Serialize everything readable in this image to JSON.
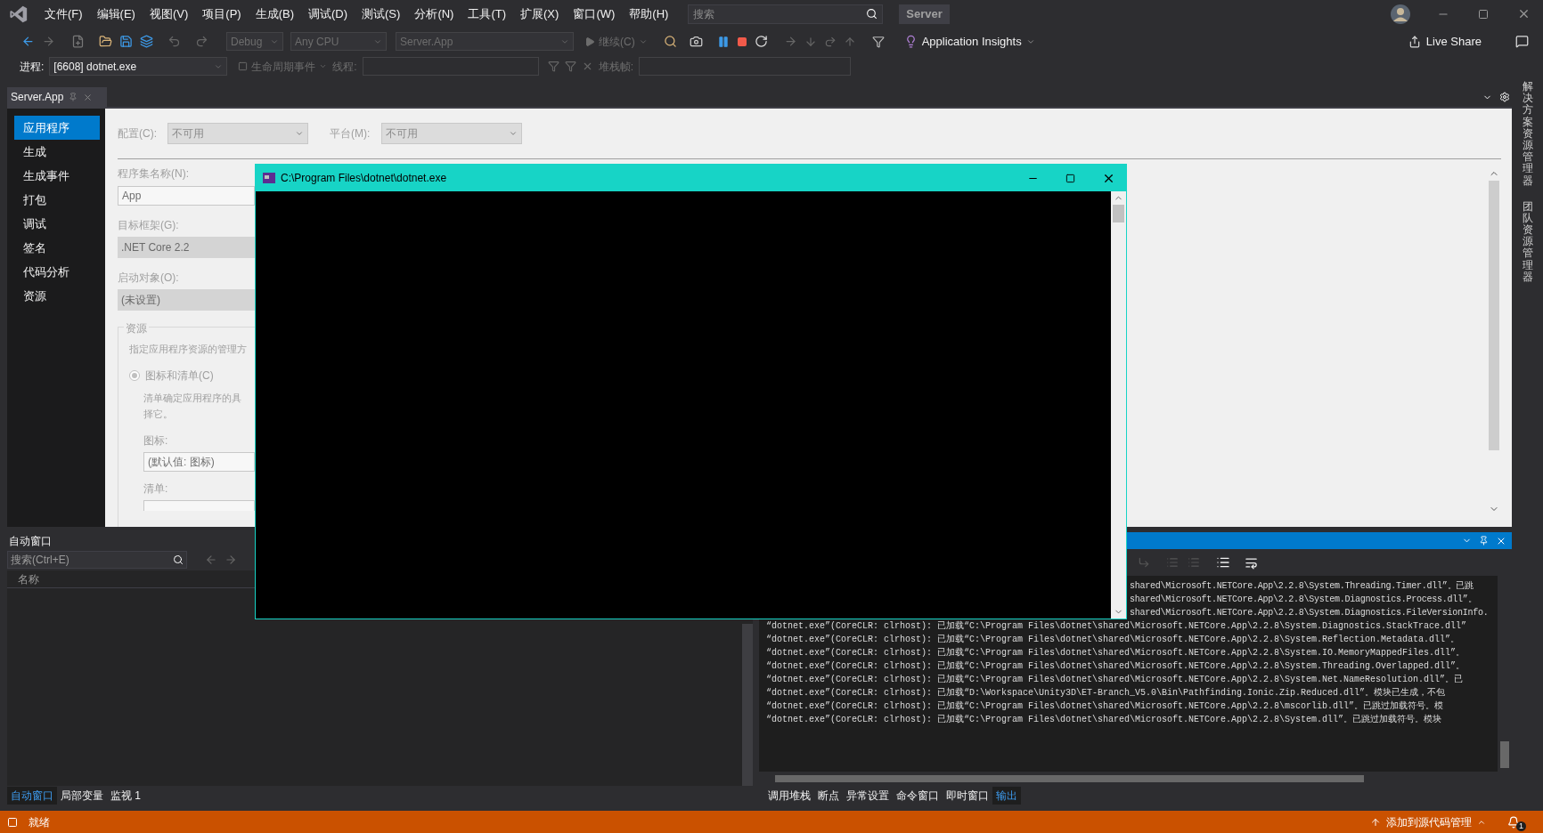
{
  "menu_bar": {
    "items": [
      "文件(F)",
      "编辑(E)",
      "视图(V)",
      "项目(P)",
      "生成(B)",
      "调试(D)",
      "测试(S)",
      "分析(N)",
      "工具(T)",
      "扩展(X)",
      "窗口(W)",
      "帮助(H)"
    ],
    "search": {
      "placeholder": "搜索"
    },
    "solution_badge": "Server"
  },
  "toolbar": {
    "configuration": {
      "value": "Debug",
      "disabled": true
    },
    "platform": {
      "value": "Any CPU",
      "disabled": true
    },
    "startup_project": {
      "value": "Server.App",
      "disabled": true
    },
    "continue_button": {
      "label": "继续(C)",
      "disabled": true
    },
    "app_insights": "Application Insights",
    "live_share": "Live Share"
  },
  "debug_location": {
    "process_label": "进程:",
    "process": "[6608] dotnet.exe",
    "lifecycle_events": {
      "label": "生命周期事件",
      "disabled": true
    },
    "thread_label": "线程:",
    "stack_frame_label": "堆栈帧:"
  },
  "document_tab": {
    "title": "Server.App"
  },
  "project_properties": {
    "nav": [
      {
        "label": "应用程序",
        "selected": true
      },
      {
        "label": "生成",
        "selected": false
      },
      {
        "label": "生成事件",
        "selected": false
      },
      {
        "label": "打包",
        "selected": false
      },
      {
        "label": "调试",
        "selected": false
      },
      {
        "label": "签名",
        "selected": false
      },
      {
        "label": "代码分析",
        "selected": false
      },
      {
        "label": "资源",
        "selected": false
      }
    ],
    "configuration_label": "配置(C):",
    "configuration": "不可用",
    "platform_label": "平台(M):",
    "platform": "不可用",
    "assembly_name_label": "程序集名称(N):",
    "assembly_name": "App",
    "target_framework_label": "目标框架(G):",
    "target_framework": ".NET Core 2.2",
    "startup_object_label": "启动对象(O):",
    "startup_object": "(未设置)",
    "resources_group": {
      "title": "资源",
      "description": "指定应用程序资源的管理方",
      "option": {
        "label": "图标和清单(C)",
        "checked": true
      },
      "option_description": [
        "清单确定应用程序的具",
        "择它。"
      ],
      "icon_label": "图标:",
      "icon": "(默认值: 图标)",
      "manifest_label": "清单:"
    }
  },
  "side_tabs": [
    "解决方案资源管理器",
    "团队资源管理器"
  ],
  "console_window": {
    "title": "C:\\Program Files\\dotnet\\dotnet.exe"
  },
  "autos_panel": {
    "title": "自动窗口",
    "search": {
      "placeholder": "搜索(Ctrl+E)"
    },
    "columns": [
      "名称"
    ]
  },
  "output_panel": {
    "lines": [
      {
        "kind": "partial",
        "text": "shared\\Microsoft.NETCore.App\\2.2.8\\System.Threading.Timer.dll”。已跳"
      },
      {
        "kind": "partial",
        "text": "shared\\Microsoft.NETCore.App\\2.2.8\\System.Diagnostics.Process.dll”。"
      },
      {
        "kind": "partial",
        "text": "shared\\Microsoft.NETCore.App\\2.2.8\\System.Diagnostics.FileVersionInfo."
      },
      {
        "kind": "full",
        "text": "“dotnet.exe”(CoreCLR: clrhost): 已加载“C:\\Program Files\\dotnet\\shared\\Microsoft.NETCore.App\\2.2.8\\System.Diagnostics.StackTrace.dll”"
      },
      {
        "kind": "full",
        "text": "“dotnet.exe”(CoreCLR: clrhost): 已加载“C:\\Program Files\\dotnet\\shared\\Microsoft.NETCore.App\\2.2.8\\System.Reflection.Metadata.dll”。"
      },
      {
        "kind": "full",
        "text": "“dotnet.exe”(CoreCLR: clrhost): 已加载“C:\\Program Files\\dotnet\\shared\\Microsoft.NETCore.App\\2.2.8\\System.IO.MemoryMappedFiles.dll”。"
      },
      {
        "kind": "full",
        "text": "“dotnet.exe”(CoreCLR: clrhost): 已加载“C:\\Program Files\\dotnet\\shared\\Microsoft.NETCore.App\\2.2.8\\System.Threading.Overlapped.dll”。"
      },
      {
        "kind": "full",
        "text": "“dotnet.exe”(CoreCLR: clrhost): 已加载“C:\\Program Files\\dotnet\\shared\\Microsoft.NETCore.App\\2.2.8\\System.Net.NameResolution.dll”。已"
      },
      {
        "kind": "full",
        "text": "“dotnet.exe”(CoreCLR: clrhost): 已加载“D:\\Workspace\\Unity3D\\ET-Branch_V5.0\\Bin\\Pathfinding.Ionic.Zip.Reduced.dll”。模块已生成，不包"
      },
      {
        "kind": "full",
        "text": "“dotnet.exe”(CoreCLR: clrhost): 已加载“C:\\Program Files\\dotnet\\shared\\Microsoft.NETCore.App\\2.2.8\\mscorlib.dll”。已跳过加载符号。模"
      },
      {
        "kind": "full",
        "text": "“dotnet.exe”(CoreCLR: clrhost): 已加载“C:\\Program Files\\dotnet\\shared\\Microsoft.NETCore.App\\2.2.8\\System.dll”。已跳过加载符号。模块"
      }
    ]
  },
  "bottom_left_tabs": [
    {
      "label": "自动窗口",
      "selected": true
    },
    {
      "label": "局部变量",
      "selected": false
    },
    {
      "label": "监视 1",
      "selected": false
    }
  ],
  "bottom_right_tabs": [
    {
      "label": "调用堆栈",
      "selected": false
    },
    {
      "label": "断点",
      "selected": false
    },
    {
      "label": "异常设置",
      "selected": false
    },
    {
      "label": "命令窗口",
      "selected": false
    },
    {
      "label": "即时窗口",
      "selected": false
    },
    {
      "label": "输出",
      "selected": true
    }
  ],
  "status_bar": {
    "text": "就绪",
    "source_control": "添加到源代码管理",
    "notifications": "1"
  }
}
